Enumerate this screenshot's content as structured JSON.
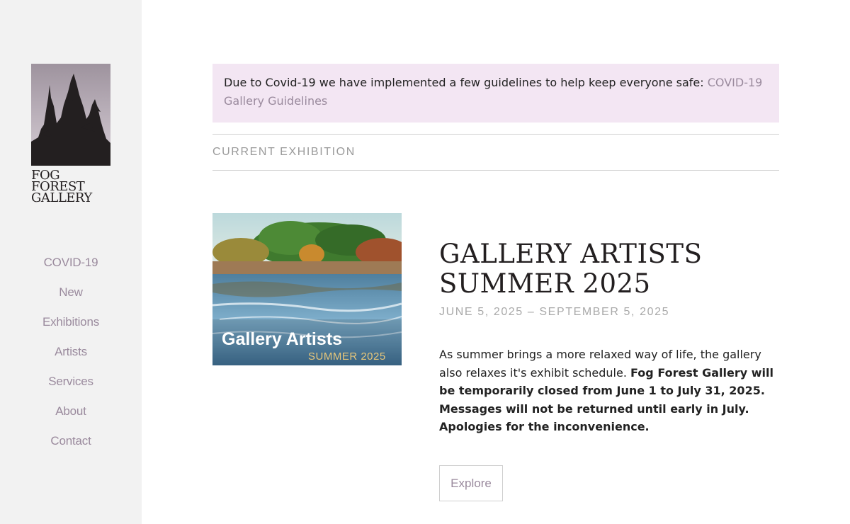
{
  "brand": {
    "logo_lines": [
      "FOG",
      "FOREST",
      "GALLERY"
    ]
  },
  "nav": {
    "items": [
      "COVID-19",
      "New",
      "Exhibitions",
      "Artists",
      "Services",
      "About",
      "Contact"
    ]
  },
  "notice": {
    "text": "Due to Covid-19 we have implemented a few guidelines to help keep everyone safe: ",
    "link": "COVID-19 Gallery Guidelines"
  },
  "section": {
    "heading": "CURRENT EXHIBITION"
  },
  "exhibition": {
    "image_title": "Gallery Artists",
    "image_subtitle": "SUMMER 2025",
    "title": "GALLERY ARTISTS SUMMER 2025",
    "dates": "JUNE 5, 2025 – SEPTEMBER 5, 2025",
    "description": "As summer brings a more relaxed way of life, the gallery also relaxes it's exhibit schedule.  ",
    "description_bold": "Fog Forest Gallery will be temporarily closed from June 1 to July 31, 2025. Messages will not be returned until early in July. Apologies for the inconvenience.",
    "button": "Explore"
  },
  "colors": {
    "sidebar_bg": "#f2f2f2",
    "accent": "#9a8a9d",
    "notice_bg": "#f3e6f3"
  }
}
